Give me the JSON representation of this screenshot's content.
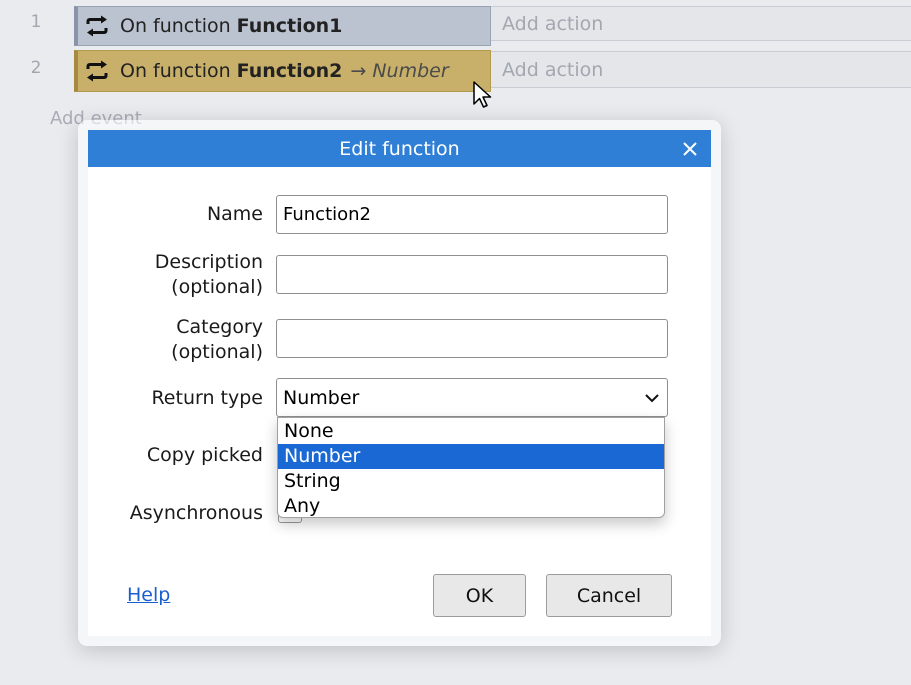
{
  "event_sheet": {
    "events": [
      {
        "number": "1",
        "prefix": "On function",
        "name": "Function1",
        "arrow": "",
        "return_type": "",
        "action_placeholder": "Add action"
      },
      {
        "number": "2",
        "prefix": "On function",
        "name": "Function2",
        "arrow": "→",
        "return_type": "Number",
        "action_placeholder": "Add action"
      }
    ],
    "add_event_label": "Add event"
  },
  "dialog": {
    "title": "Edit function",
    "fields": {
      "name": {
        "label": "Name",
        "value": "Function2"
      },
      "description": {
        "label_line1": "Description",
        "label_line2": "(optional)",
        "value": ""
      },
      "category": {
        "label_line1": "Category",
        "label_line2": "(optional)",
        "value": ""
      },
      "return_type": {
        "label": "Return type",
        "selected": "Number",
        "options": [
          "None",
          "Number",
          "String",
          "Any"
        ]
      },
      "copy_picked": {
        "label": "Copy picked"
      },
      "asynchronous": {
        "label": "Asynchronous"
      }
    },
    "help_label": "Help",
    "ok_label": "OK",
    "cancel_label": "Cancel"
  },
  "colors": {
    "title_bar": "#2f7fd6",
    "selected_option": "#1a68d4",
    "function_event_highlight": "#c8b06a"
  }
}
